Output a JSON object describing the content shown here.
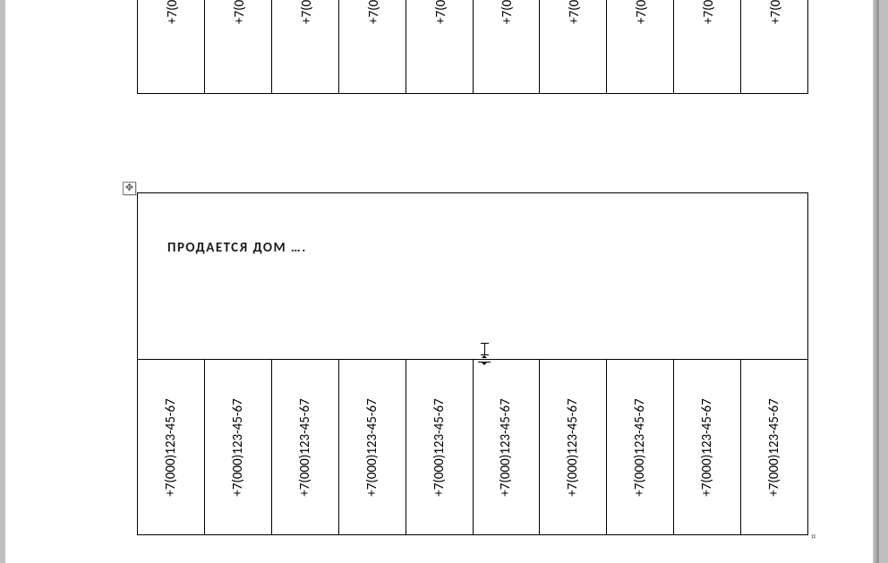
{
  "flyer": {
    "title": "ПРОДАЕТСЯ  ДОМ ….",
    "phone_full": "+7(000)123-45-67",
    "phone_cropped": "+7(000",
    "tab_count": 10
  }
}
